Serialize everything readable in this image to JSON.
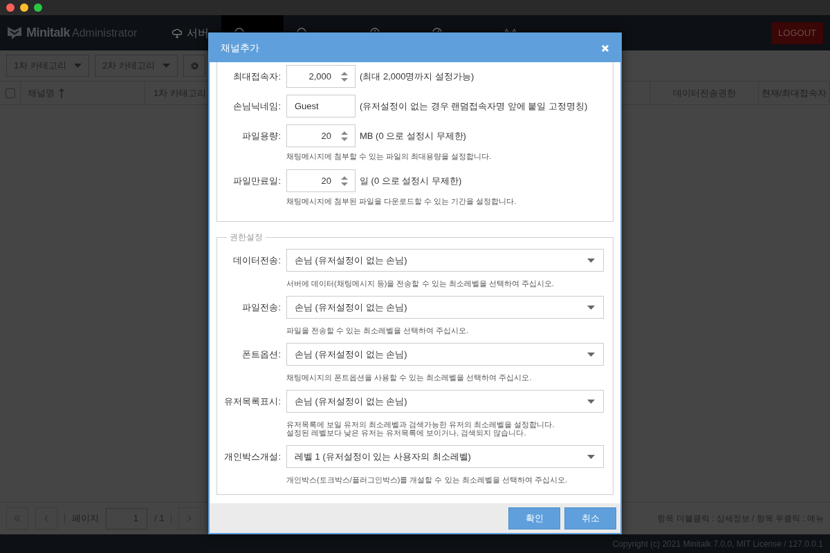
{
  "app": {
    "brand": "Minitalk",
    "brand_sub": "Administrator",
    "logout": "LOGOUT",
    "nav": [
      {
        "label": "서버",
        "selected": false
      },
      {
        "selected": true
      },
      {
        "selected": false
      },
      {
        "selected": false
      },
      {
        "selected": false
      },
      {
        "selected": false
      }
    ]
  },
  "toolbar": {
    "category1": "1차 카테고리",
    "category2": "2차 카테고리"
  },
  "table": {
    "select_all_checked": false,
    "columns": [
      "채널명",
      "1차 카테고리",
      "데이터전송권한",
      "현재/최대접속자"
    ]
  },
  "pagination": {
    "label": "페이지",
    "page": "1",
    "total": "/ 1"
  },
  "status_hint": "항목 더블클릭 : 상세정보 / 항목 우클릭 : 메뉴",
  "copyright": "Copyright (c) 2021 Minitalk 7.0.0, MIT License / 127.0.0.1",
  "dialog": {
    "title": "채널추가",
    "fields": [
      {
        "kind": "number",
        "label": "최대접속자:",
        "value": "2,000",
        "note": "(최대 2,000명까지 설정가능)"
      },
      {
        "kind": "text",
        "label": "손님닉네임:",
        "value": "Guest",
        "note": "(유저설정이 없는 경우 랜덤접속자명 앞에 붙일 고정명칭)"
      },
      {
        "kind": "number",
        "label": "파일용량:",
        "value": "20",
        "note": "MB (0 으로 설정시 무제한)",
        "help": [
          "채팅메시지에 첨부할 수 있는 파일의 최대용량을 설정합니다."
        ]
      },
      {
        "kind": "number",
        "label": "파일만료일:",
        "value": "20",
        "note": "일 (0 으로 설정시 무제한)",
        "help": [
          "채팅메시지에 첨부된 파일을 다운로드할 수 있는 기간을 설정합니다."
        ]
      }
    ],
    "permissions": {
      "legend": "권한설정",
      "fields": [
        {
          "label": "데이터전송:",
          "value": "손님 (유저설정이 없는 손님)",
          "help": [
            "서버에 데이터(채팅메시지 등)을 전송할 수 있는 최소레벨을 선택하여 주십시오."
          ]
        },
        {
          "label": "파일전송:",
          "value": "손님 (유저설정이 없는 손님)",
          "help": [
            "파일을 전송할 수 있는 최소레벨을 선택하여 주십시오."
          ]
        },
        {
          "label": "폰트옵션:",
          "value": "손님 (유저설정이 없는 손님)",
          "help": [
            "채팅메시지의 폰트옵션을 사용할 수 있는 최소레벨을 선택하여 주십시오."
          ]
        },
        {
          "label": "유저목록표시:",
          "value": "손님 (유저설정이 없는 손님)",
          "help": [
            "유저목록에 보일 유저의 최소레벨과 검색가능한 유저의 최소레벨을 설정합니다.",
            "설정된 레벨보다 낮은 유저는 유저목록에 보이거나, 검색되지 않습니다."
          ]
        },
        {
          "label": "개인박스개설:",
          "value": "레벨 1 (유저설정이 있는 사용자의 최소레벨)",
          "help": [
            "개인박스(토크박스/플러그인박스)를 개설할 수 있는 최소레벨을 선택하여 주십시오."
          ]
        }
      ]
    },
    "buttons": [
      "확인",
      "취소"
    ]
  }
}
